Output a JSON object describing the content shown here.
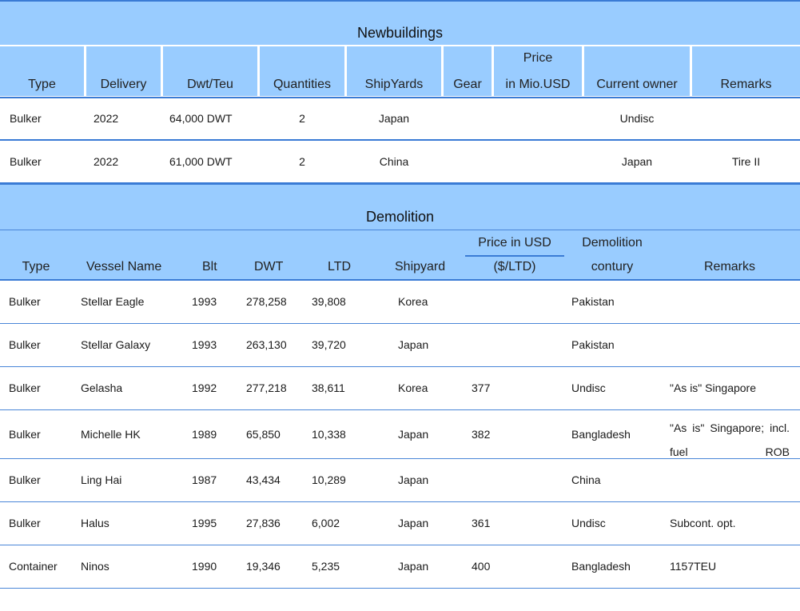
{
  "newbuildings": {
    "title": "Newbuildings",
    "headers": {
      "type": "Type",
      "delivery": "Delivery",
      "dwt_teu": "Dwt/Teu",
      "quantities": "Quantities",
      "shipyards": "ShipYards",
      "gear": "Gear",
      "price_line1": "Price",
      "price_line2": "in Mio.USD",
      "current_owner": "Current owner",
      "remarks": "Remarks"
    },
    "rows": [
      {
        "type": "Bulker",
        "delivery": "2022",
        "dwt": "64,000 DWT",
        "quantities": "2",
        "shipyards": "Japan",
        "gear": "",
        "price": "",
        "owner": "Undisc",
        "remarks": ""
      },
      {
        "type": "Bulker",
        "delivery": "2022",
        "dwt": "61,000 DWT",
        "quantities": "2",
        "shipyards": "China",
        "gear": "",
        "price": "",
        "owner": "Japan",
        "remarks": "Tire II"
      }
    ]
  },
  "demolition": {
    "title": "Demolition",
    "headers": {
      "type": "Type",
      "vessel_name": "Vessel Name",
      "blt": "Blt",
      "dwt": "DWT",
      "ltd": "LTD",
      "shipyard": "Shipyard",
      "price_line1": "Price in USD",
      "price_line2": "($/LTD)",
      "demolition_line1": "Demolition",
      "demolition_line2": "contury",
      "remarks": "Remarks"
    },
    "rows": [
      {
        "type": "Bulker",
        "vessel": "Stellar Eagle",
        "blt": "1993",
        "dwt": "278,258",
        "ltd": "39,808",
        "shipyard": "Korea",
        "price": "",
        "country": "Pakistan",
        "remarks": ""
      },
      {
        "type": "Bulker",
        "vessel": "Stellar Galaxy",
        "blt": "1993",
        "dwt": "263,130",
        "ltd": "39,720",
        "shipyard": "Japan",
        "price": "",
        "country": "Pakistan",
        "remarks": ""
      },
      {
        "type": "Bulker",
        "vessel": "Gelasha",
        "blt": "1992",
        "dwt": "277,218",
        "ltd": "38,611",
        "shipyard": "Korea",
        "price": "377",
        "country": "Undisc",
        "remarks": "\"As is\" Singapore"
      },
      {
        "type": "Bulker",
        "vessel": "Michelle HK",
        "blt": "1989",
        "dwt": "65,850",
        "ltd": "10,338",
        "shipyard": "Japan",
        "price": "382",
        "country": "Bangladesh",
        "remarks": "\"As is\" Singapore; incl. fuel ROB"
      },
      {
        "type": "Bulker",
        "vessel": "Ling Hai",
        "blt": "1987",
        "dwt": "43,434",
        "ltd": "10,289",
        "shipyard": "Japan",
        "price": "",
        "country": "China",
        "remarks": ""
      },
      {
        "type": "Bulker",
        "vessel": "Halus",
        "blt": "1995",
        "dwt": "27,836",
        "ltd": "6,002",
        "shipyard": "Japan",
        "price": "361",
        "country": "Undisc",
        "remarks": "Subcont. opt."
      },
      {
        "type": "Container",
        "vessel": "Ninos",
        "blt": "1990",
        "dwt": "19,346",
        "ltd": "5,235",
        "shipyard": "Japan",
        "price": "400",
        "country": "Bangladesh",
        "remarks": "1157TEU"
      }
    ]
  }
}
